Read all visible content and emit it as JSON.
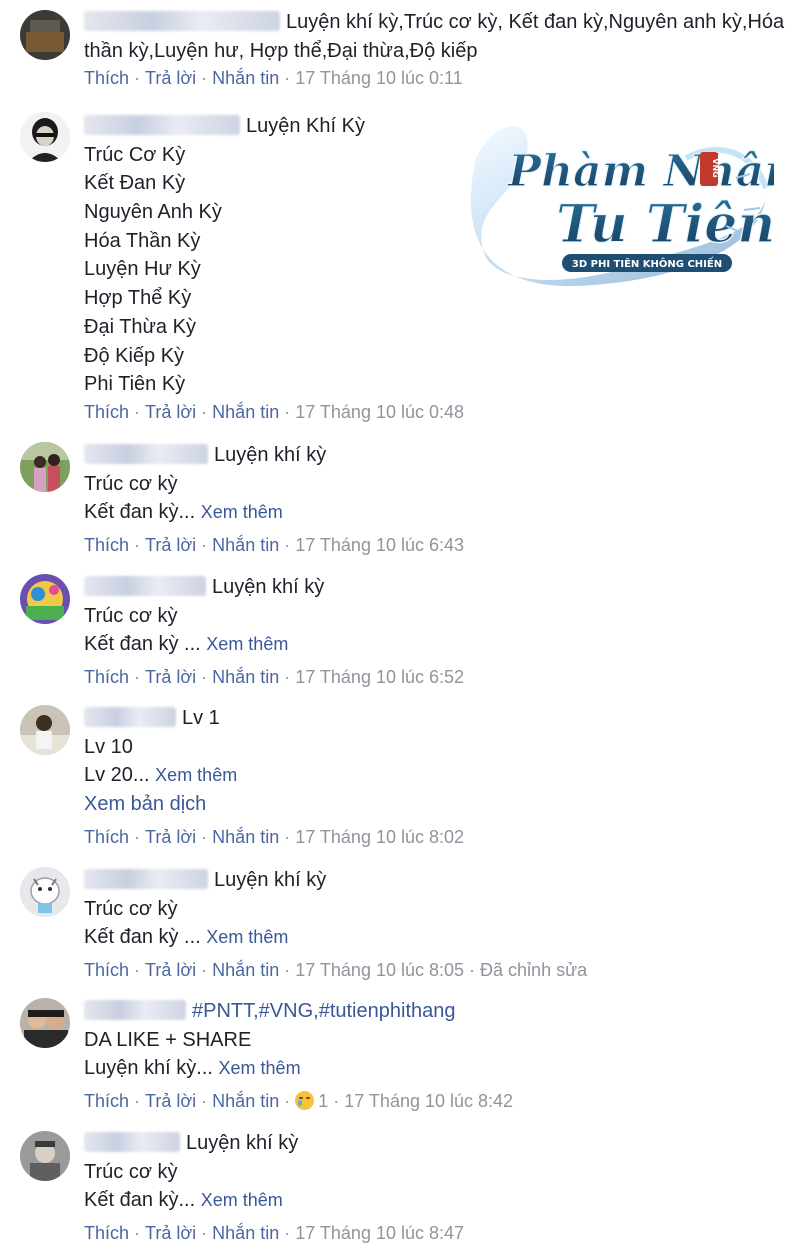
{
  "actions": {
    "like": "Thích",
    "reply": "Trả lời",
    "message": "Nhắn tin",
    "separator": "·",
    "edited": "Đã chỉnh sửa",
    "see_more": "Xem thêm",
    "see_translation": "Xem bản dịch"
  },
  "logo": {
    "line1": "Phàm Nhân",
    "line2": "Tu Tiên",
    "badge": "VNG",
    "tagline": "3D PHI TIÊN KHÔNG CHIẾN"
  },
  "comments": [
    {
      "text": "Luyện khí kỳ,Trúc cơ kỳ, Kết đan kỳ,Nguyên anh kỳ,Hóa thần kỳ,Luyện hư, Hợp thể,Đại thừa,Độ kiếp",
      "time": "17 Tháng 10 lúc 0:11"
    },
    {
      "first": "Luyện Khí Kỳ",
      "lines": [
        "Trúc Cơ Kỳ",
        "Kết Đan Kỳ",
        "Nguyên Anh Kỳ",
        "Hóa Thần Kỳ",
        "Luyện Hư Kỳ",
        "Hợp Thể Kỳ",
        "Đại Thừa Kỳ",
        "Độ Kiếp Kỳ",
        "Phi Tiên Kỳ"
      ],
      "time": "17 Tháng 10 lúc 0:48"
    },
    {
      "first": "Luyện khí kỳ",
      "line2": "Trúc cơ kỳ",
      "line3": "Kết đan kỳ...",
      "time": "17 Tháng 10 lúc 6:43"
    },
    {
      "first": "Luyện khí kỳ",
      "line2": "Trúc cơ kỳ",
      "line3": "Kết đan kỳ ...",
      "time": "17 Tháng 10 lúc 6:52"
    },
    {
      "first": "Lv 1",
      "line2": "Lv 10",
      "line3": "Lv 20...",
      "time": "17 Tháng 10 lúc 8:02"
    },
    {
      "first": "Luyện khí kỳ",
      "line2": "Trúc cơ kỳ",
      "line3": "Kết đan kỳ ...",
      "time": "17 Tháng 10 lúc 8:05"
    },
    {
      "first": "#PNTT,#VNG,#tutienphithang",
      "line2": "DA LIKE + SHARE",
      "line3": "Luyện khí kỳ...",
      "reaction_count": "1",
      "time": "17 Tháng 10 lúc 8:42"
    },
    {
      "first": "Luyện khí kỳ",
      "line2": "Trúc cơ kỳ",
      "line3": "Kết đan kỳ...",
      "time": "17 Tháng 10 lúc 8:47"
    }
  ]
}
